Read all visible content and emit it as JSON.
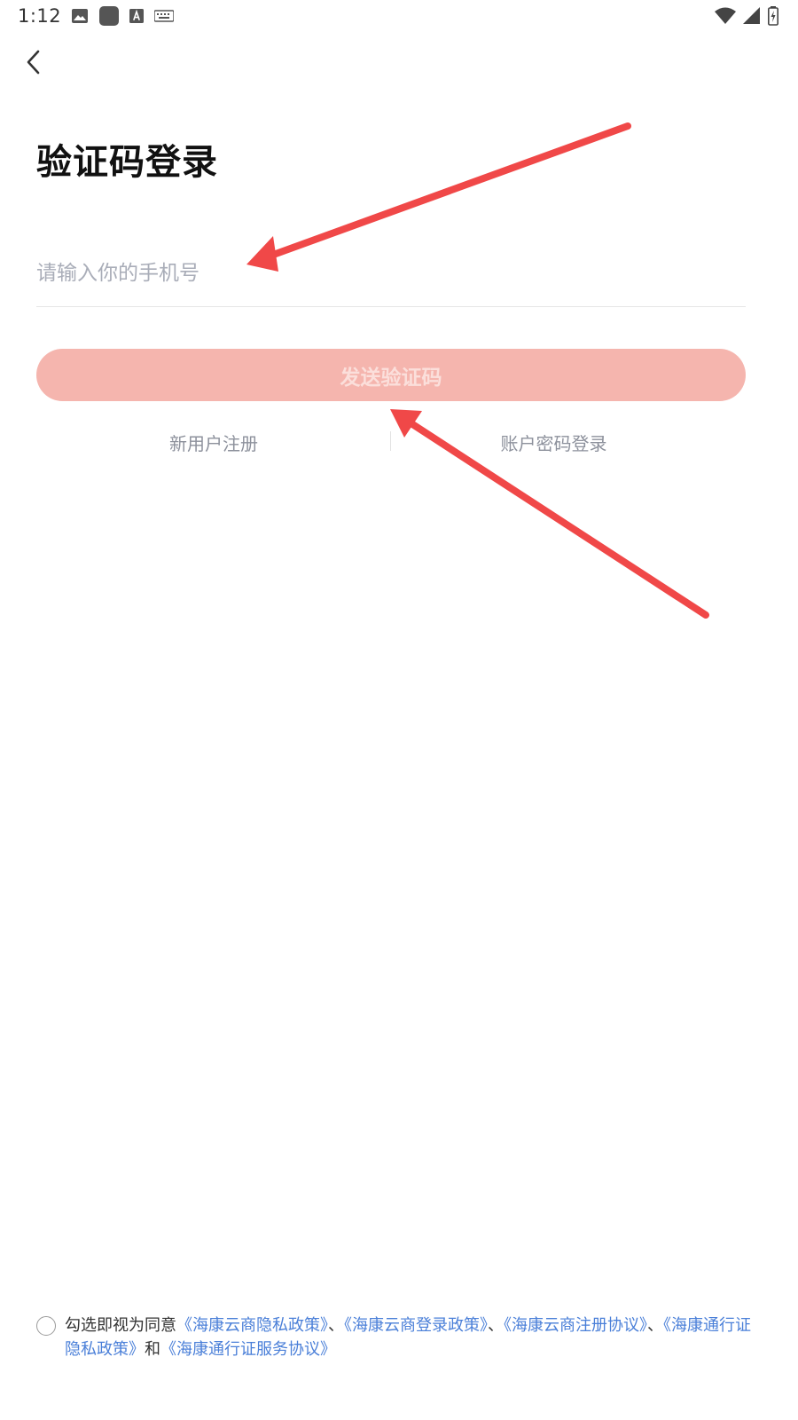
{
  "status_bar": {
    "time": "1:12",
    "left_icons": [
      "image-icon",
      "app-square-icon",
      "text-a-icon",
      "keyboard-icon"
    ],
    "right_icons": [
      "wifi-icon",
      "cell-signal-icon",
      "battery-charging-icon"
    ]
  },
  "header": {
    "back_icon": "chevron-left-icon"
  },
  "main": {
    "title": "验证码登录",
    "phone_placeholder": "请输入你的手机号",
    "phone_value": "",
    "send_code_label": "发送验证码",
    "register_link": "新用户注册",
    "password_login_link": "账户密码登录"
  },
  "agreement": {
    "prefix": "勾选即视为同意",
    "sep": "、",
    "and": "和",
    "links": [
      "《海康云商隐私政策》",
      "《海康云商登录政策》",
      "《海康云商注册协议》",
      "《海康通行证隐私政策》",
      "《海康通行证服务协议》"
    ]
  },
  "colors": {
    "accent_disabled": "#f5b5ae",
    "link": "#4a7fd8",
    "arrow": "#f04848"
  }
}
